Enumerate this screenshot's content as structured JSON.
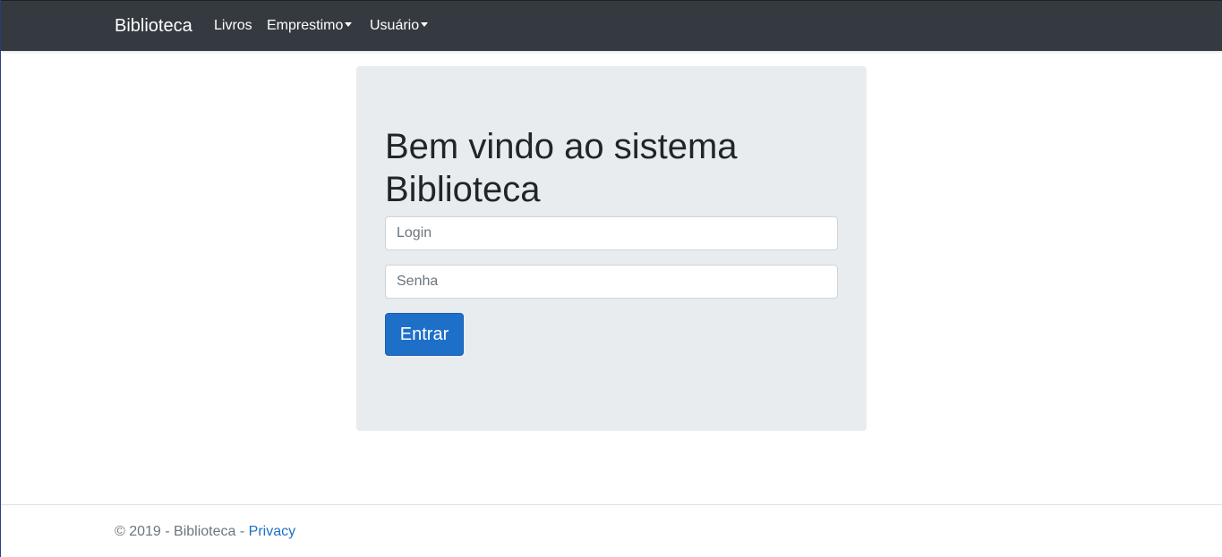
{
  "navbar": {
    "brand": "Biblioteca",
    "items": [
      {
        "label": "Livros",
        "dropdown": false
      },
      {
        "label": "Emprestimo",
        "dropdown": true
      },
      {
        "label": "Usuário",
        "dropdown": true
      }
    ]
  },
  "main": {
    "heading_line1": "Bem vindo ao sistema",
    "heading_line2": "Biblioteca",
    "login": {
      "value": "",
      "placeholder": "Login"
    },
    "senha": {
      "value": "",
      "placeholder": "Senha"
    },
    "submit_label": "Entrar"
  },
  "footer": {
    "text": "© 2019 - Biblioteca - ",
    "link_label": "Privacy"
  },
  "colors": {
    "navbar_bg": "#343a40",
    "jumbotron_bg": "#e9ecef",
    "primary": "#1e6fc8"
  }
}
